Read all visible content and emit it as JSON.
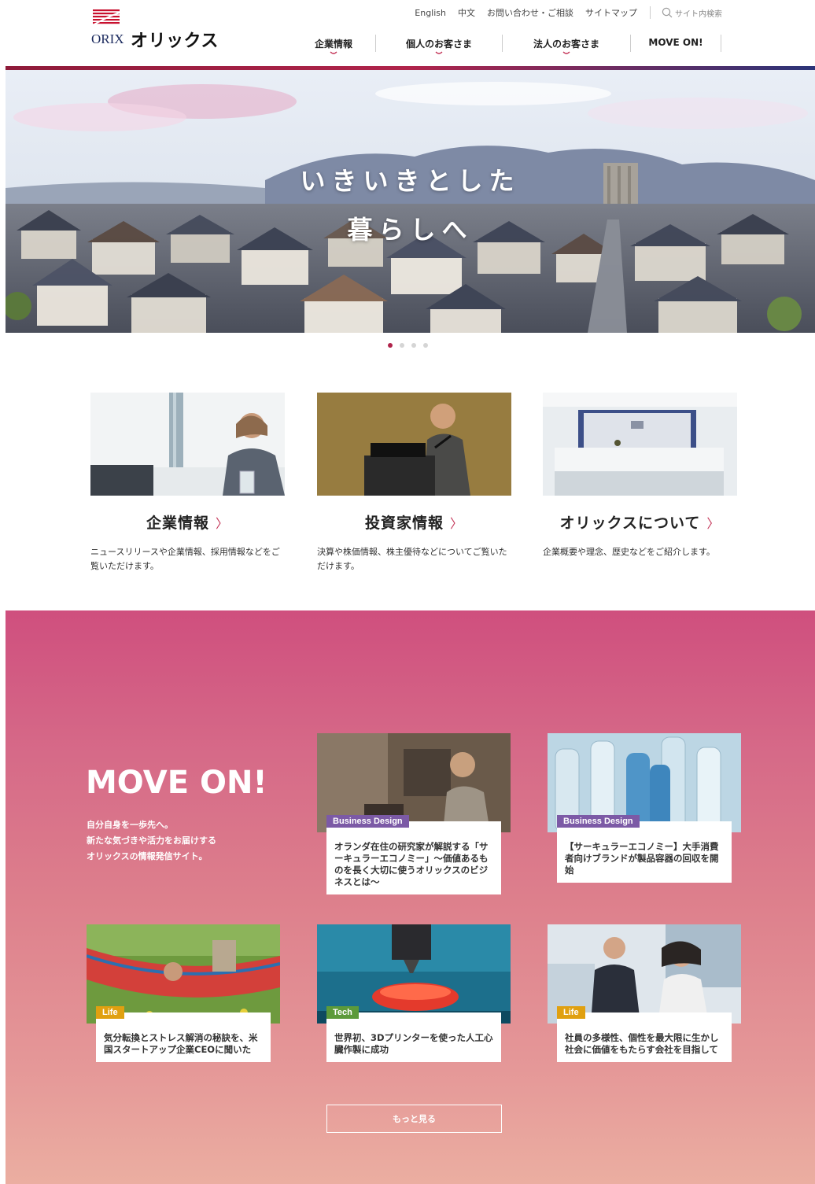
{
  "brand": {
    "logo_en": "ORIX",
    "logo_ja": "オリックス",
    "accent": "#b0244b",
    "navy": "#2b3478"
  },
  "utility": {
    "english": "English",
    "chinese": "中文",
    "contact": "お問い合わせ・ご相談",
    "sitemap": "サイトマップ",
    "search_placeholder": "サイト内検索"
  },
  "gnav": [
    {
      "label": "企業情報",
      "has_dropdown": true
    },
    {
      "label": "個人のお客さま",
      "has_dropdown": true
    },
    {
      "label": "法人のお客さま",
      "has_dropdown": true
    },
    {
      "label": "MOVE ON!",
      "has_dropdown": false
    }
  ],
  "hero": {
    "line1": "いきいきとした",
    "line2": "暮らしへ",
    "slide_count": 4,
    "active_slide": 1
  },
  "cards": [
    {
      "title": "企業情報",
      "desc": "ニュースリリースや企業情報、採用情報などをご覧いただけます。",
      "image": "businesswoman-office-photo"
    },
    {
      "title": "投資家情報",
      "desc": "決算や株価情報、株主優待などについてご覧いただけます。",
      "image": "speaker-podium-photo"
    },
    {
      "title": "オリックスについて",
      "desc": "企業概要や理念、歴史などをご紹介します。",
      "image": "orix-reception-photo"
    }
  ],
  "card_arrow": "〉",
  "moveon": {
    "logo": "MOVE ON!",
    "desc_line1": "自分自身を一歩先へ。",
    "desc_line2": "新たな気づきや活力をお届けする",
    "desc_line3": "オリックスの情報発信サイト。",
    "more_label": "もっと見る",
    "articles": [
      {
        "tag": "Business Design",
        "text": "オランダ在住の研究家が解説する「サーキュラーエコノミー」〜価値あるものを長く大切に使うオリックスのビジネスとは〜",
        "image": "researcher-photo"
      },
      {
        "tag": "Business Design",
        "text": "【サーキュラーエコノミー】大手消費者向けブランドが製品容器の回収を開始",
        "image": "plastic-bottles-photo"
      },
      {
        "tag": "Life",
        "text": "気分転換とストレス解消の秘訣を、米国スタートアップ企業CEOに聞いた",
        "image": "hammock-photo"
      },
      {
        "tag": "Tech",
        "text": "世界初、3Dプリンターを使った人工心臓作製に成功",
        "image": "3d-printer-photo"
      },
      {
        "tag": "Life",
        "text": "社員の多様性、個性を最大限に生かし社会に価値をもたらす会社を目指して",
        "image": "executives-photo"
      }
    ]
  }
}
